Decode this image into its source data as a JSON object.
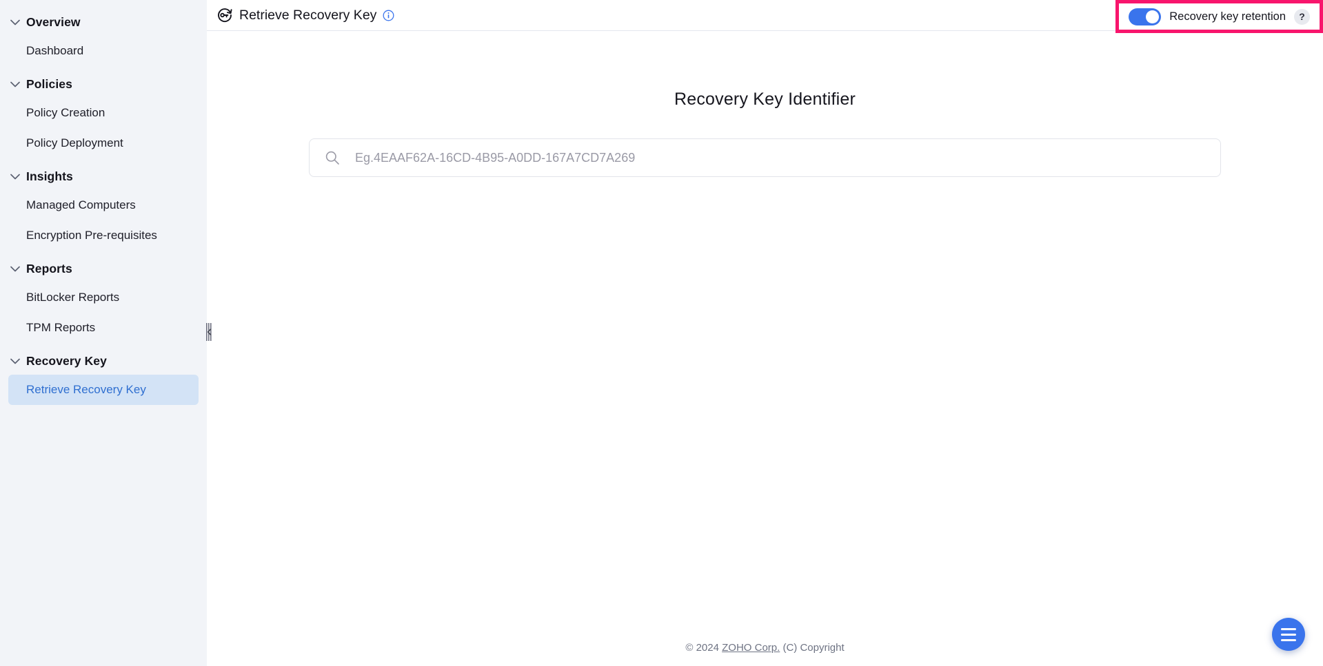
{
  "sidebar": {
    "groups": [
      {
        "title": "Overview",
        "chevron_icon": "chevron-down-icon",
        "items": [
          {
            "label": "Dashboard",
            "active": false
          }
        ]
      },
      {
        "title": "Policies",
        "chevron_icon": "chevron-down-icon",
        "items": [
          {
            "label": "Policy Creation",
            "active": false
          },
          {
            "label": "Policy Deployment",
            "active": false
          }
        ]
      },
      {
        "title": "Insights",
        "chevron_icon": "chevron-down-icon",
        "items": [
          {
            "label": "Managed Computers",
            "active": false
          },
          {
            "label": "Encryption Pre-requisites",
            "active": false
          }
        ]
      },
      {
        "title": "Reports",
        "chevron_icon": "chevron-down-icon",
        "items": [
          {
            "label": "BitLocker Reports",
            "active": false
          },
          {
            "label": "TPM Reports",
            "active": false
          }
        ]
      },
      {
        "title": "Recovery Key",
        "chevron_icon": "chevron-down-icon",
        "items": [
          {
            "label": "Retrieve Recovery Key",
            "active": true
          }
        ]
      }
    ],
    "resize_handle_icon": "collapse-sidebar-handle-icon",
    "active_item_bg": "#d3e3f6",
    "active_item_color": "#2f6fd0",
    "background": "#f2f4f8"
  },
  "header": {
    "page_icon": "recovery-key-icon",
    "title": "Retrieve Recovery Key",
    "info_icon": "info-icon",
    "retention": {
      "toggle_state": "on",
      "toggle_color": "#3a74ec",
      "label": "Recovery key retention",
      "help_label": "?",
      "highlight_color": "#f8156c"
    }
  },
  "main": {
    "heading": "Recovery Key Identifier",
    "search": {
      "icon": "search-icon",
      "value": "",
      "placeholder": "Eg.4EAAF62A-16CD-4B95-A0DD-167A7CD7A269"
    }
  },
  "footer": {
    "prefix": "© 2024 ",
    "link": "ZOHO Corp.",
    "suffix": " (C) Copyright"
  },
  "fab": {
    "icon": "menu-icon",
    "color": "#3a74ec"
  }
}
